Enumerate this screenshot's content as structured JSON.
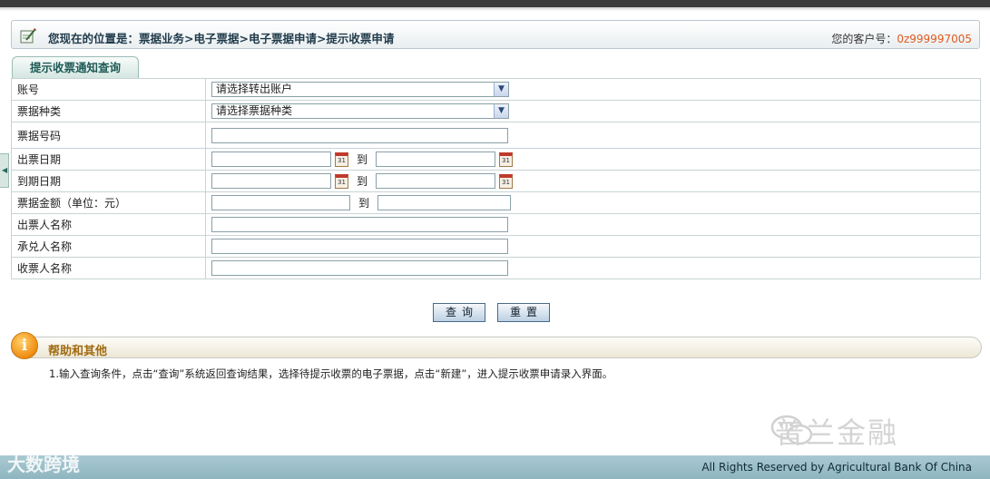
{
  "location": {
    "text": "您现在的位置是：票据业务>电子票据>电子票据申请>提示收票申请",
    "customer_label": "您的客户号：",
    "customer_no": "0z999997005"
  },
  "tab": {
    "label": "提示收票通知查询"
  },
  "form": {
    "rows": [
      {
        "label": "账号",
        "select_value": "请选择转出账户"
      },
      {
        "label": "票据种类",
        "select_value": "请选择票据种类"
      },
      {
        "label": "票据号码"
      },
      {
        "label": "出票日期",
        "to_label": "到"
      },
      {
        "label": "到期日期",
        "to_label": "到"
      },
      {
        "label": "票据金额（单位：元）",
        "to_label": "到"
      },
      {
        "label": "出票人名称"
      },
      {
        "label": "承兑人名称"
      },
      {
        "label": "收票人名称"
      }
    ],
    "calendar_icon_text": "31"
  },
  "buttons": {
    "query": "查询",
    "reset": "重置"
  },
  "help": {
    "title": "帮助和其他",
    "icon_text": "i",
    "text": "1.输入查询条件，点击“查询”系统返回查询结果，选择待提示收票的电子票据，点击“新建”，进入提示收票申请录入界面。"
  },
  "watermark": {
    "text": "普兰金融",
    "logo": "大数跨境"
  },
  "footer": {
    "text": "All Rights Reserved by Agricultural Bank Of China"
  },
  "colors": {
    "accent": "#e05a1e",
    "footer": "#9dc1ca",
    "help": "#f08c12"
  },
  "icons": {
    "location": "pencil-note-icon",
    "calendar": "calendar-icon",
    "help": "info-icon",
    "select": "chevron-down-icon"
  }
}
